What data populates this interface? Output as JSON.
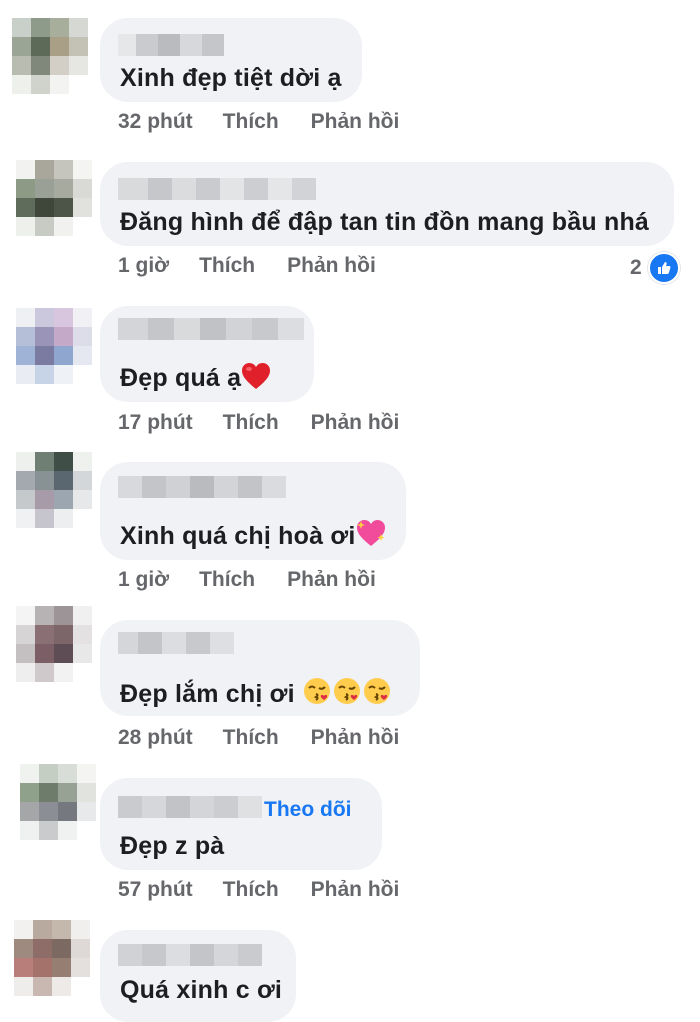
{
  "comments": [
    {
      "text": "Xinh đẹp tiệt dời ạ",
      "emoji": "",
      "time": "32 phút",
      "like": "Thích",
      "reply": "Phản hồi"
    },
    {
      "text": "Đăng hình để đập tan tin đồn mang bầu nhá",
      "emoji": "",
      "time": "1 giờ",
      "like": "Thích",
      "reply": "Phản hồi",
      "reaction_count": "2",
      "reaction_icon": "like-icon"
    },
    {
      "text": "Đẹp quá ạ",
      "emoji": "heart-emoji",
      "time": "17 phút",
      "like": "Thích",
      "reply": "Phản hồi"
    },
    {
      "text": "Xinh quá chị hoà ơi",
      "emoji": "sparkling-heart-emoji",
      "time": "1 giờ",
      "like": "Thích",
      "reply": "Phản hồi"
    },
    {
      "text": "Đẹp lắm chị ơi",
      "emoji": "kissing-face-emoji x3",
      "time": "28 phút",
      "like": "Thích",
      "reply": "Phản hồi"
    },
    {
      "text": "Đẹp z pà",
      "emoji": "",
      "follow": "Theo dõi",
      "time": "57 phút",
      "like": "Thích",
      "reply": "Phản hồi"
    },
    {
      "text": "Quá xinh c ơi",
      "emoji": ""
    }
  ],
  "colors": {
    "bubble": "#f0f2f5",
    "meta": "#65676b",
    "text": "#1c1e21",
    "link": "#1877f2"
  }
}
